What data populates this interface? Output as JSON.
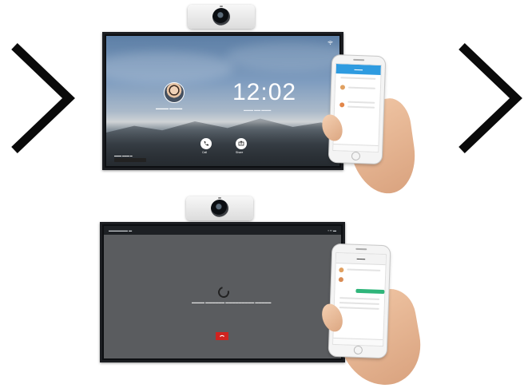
{
  "colors": {
    "chevron": "#0a0a0a",
    "end_button": "#d0231f",
    "app_header": "#2e9be0",
    "in_call_background": "#5a5c5f",
    "chat_bubble": "#2fb57a"
  },
  "icons": {
    "left_arrow": "chevron-right-icon",
    "right_arrow": "chevron-right-icon",
    "call": "phone-icon",
    "share": "share-icon",
    "end": "hang-up-icon",
    "wifi": "wifi-icon"
  },
  "top_screen": {
    "clock": "12:02",
    "call_label": "Call",
    "share_label": "Share"
  }
}
